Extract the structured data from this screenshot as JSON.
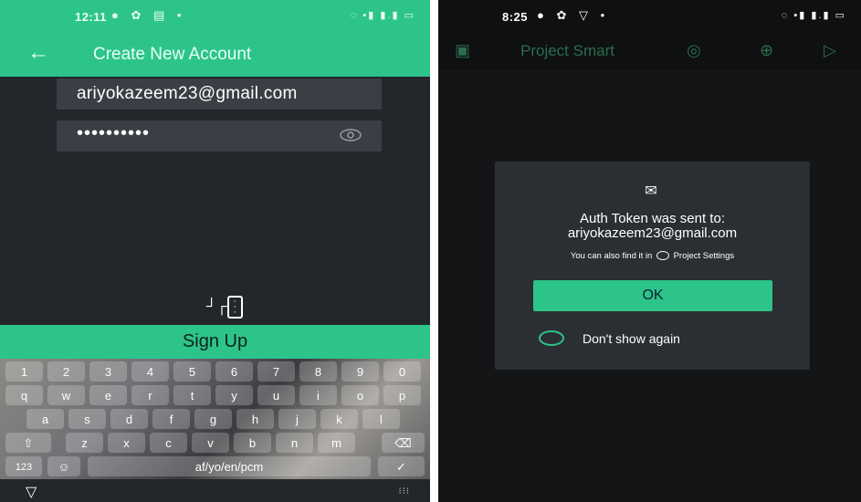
{
  "left": {
    "status": {
      "time": "12:11",
      "left_icons": "● ✿ ▤ •",
      "right_icons": "◌ ▪▮ ▮.▮ ▭"
    },
    "header": {
      "back_icon": "←",
      "title": "Create New Account"
    },
    "email_value": "ariyokazeem23@gmail.com",
    "password_value": "••••••••••",
    "signup_label": "Sign Up",
    "keyboard": {
      "row1": [
        "1",
        "2",
        "3",
        "4",
        "5",
        "6",
        "7",
        "8",
        "9",
        "0"
      ],
      "row2": [
        "q",
        "w",
        "e",
        "r",
        "t",
        "y",
        "u",
        "i",
        "o",
        "p"
      ],
      "row3": [
        "a",
        "s",
        "d",
        "f",
        "g",
        "h",
        "j",
        "k",
        "l"
      ],
      "row4": [
        "z",
        "x",
        "c",
        "v",
        "b",
        "n",
        "m"
      ],
      "symbols_key": "123",
      "emoji_key": "☺",
      "space_label": "af/yo/en/pcm",
      "shift_icon": "⇧",
      "backspace_icon": "⌫",
      "enter_icon": "✓"
    },
    "nav": {
      "back_icon": "▽",
      "kb_icon": "⁝⁝⁝"
    }
  },
  "right": {
    "status": {
      "time": "8:25",
      "left_icons": "● ✿ ▽ •",
      "right_icons": "◌ ▪▮ ▮.▮ ▭"
    },
    "toolbar": {
      "device_icon": "▣",
      "title": "Project Smart",
      "settings_icon": "◎",
      "add_icon": "⊕",
      "play_icon": "▷"
    },
    "dialog": {
      "mail_icon": "✉",
      "title": "Auth Token was sent to:",
      "email": "ariyokazeem23@gmail.com",
      "hint_prefix": "You can also find it in",
      "hint_suffix": "Project Settings",
      "ok_label": "OK",
      "dont_show_label": "Don't show again"
    }
  }
}
